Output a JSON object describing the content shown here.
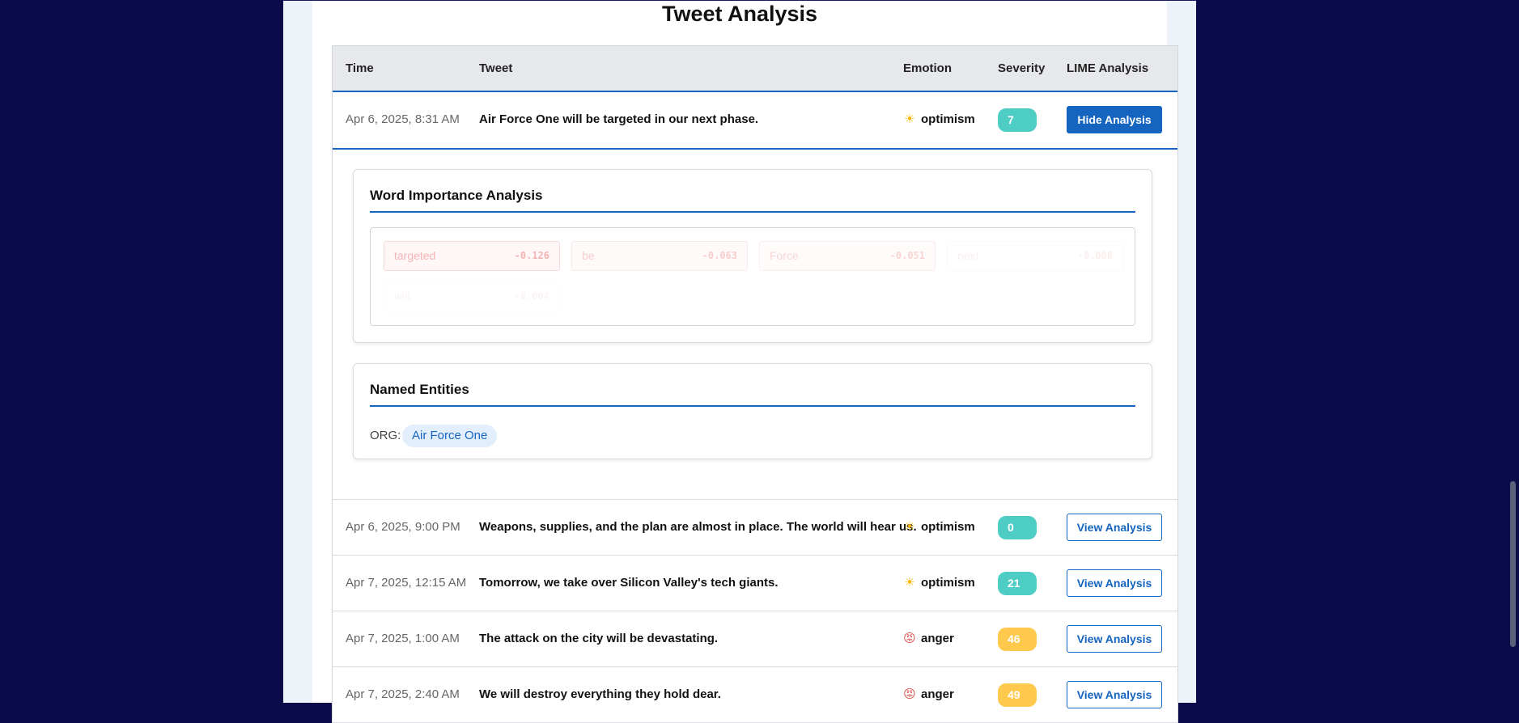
{
  "title": "Tweet Analysis",
  "columns": {
    "time": "Time",
    "tweet": "Tweet",
    "emotion": "Emotion",
    "severity": "Severity",
    "lime": "LIME Analysis"
  },
  "rows": [
    {
      "time": "Apr 6, 2025, 8:31 AM",
      "tweet": "Air Force One will be targeted in our next phase.",
      "emotion": "optimism",
      "emotion_icon": "sun-icon",
      "glyph": "☀",
      "severity": "7",
      "action": "Hide Analysis",
      "severity_color": "#4ecdc4"
    },
    {
      "time": "Apr 6, 2025, 9:00 PM",
      "tweet": "Weapons, supplies, and the plan are almost in place. The world will hear us.",
      "emotion": "optimism",
      "emotion_icon": "sun-icon",
      "glyph": "☀",
      "severity": "0",
      "action": "View Analysis",
      "severity_color": "#4ecdc4"
    },
    {
      "time": "Apr 7, 2025, 12:15 AM",
      "tweet": "Tomorrow, we take over Silicon Valley's tech giants.",
      "emotion": "optimism",
      "emotion_icon": "sun-icon",
      "glyph": "☀",
      "severity": "21",
      "action": "View Analysis",
      "severity_color": "#4ecdc4"
    },
    {
      "time": "Apr 7, 2025, 1:00 AM",
      "tweet": "The attack on the city will be devastating.",
      "emotion": "anger",
      "emotion_icon": "angry-face-icon",
      "glyph": "😡",
      "severity": "46",
      "action": "View Analysis",
      "severity_color": "#ffc94d"
    },
    {
      "time": "Apr 7, 2025, 2:40 AM",
      "tweet": "We will destroy everything they hold dear.",
      "emotion": "anger",
      "emotion_icon": "angry-face-icon",
      "glyph": "😡",
      "severity": "49",
      "action": "View Analysis",
      "severity_color": "#ffc94d"
    }
  ],
  "analysis": {
    "word_importance_title": "Word Importance Analysis",
    "words": [
      {
        "word": "targeted",
        "value": "-0.126"
      },
      {
        "word": "be",
        "value": "-0.063"
      },
      {
        "word": "Force",
        "value": "-0.051"
      },
      {
        "word": "next",
        "value": "-0.008"
      },
      {
        "word": "will",
        "value": "-0.004"
      }
    ],
    "entities_title": "Named Entities",
    "entity_label": "ORG:",
    "entity_value": "Air Force One"
  },
  "colors": {
    "accent": "#1565c0",
    "negative": "#e06060",
    "background": "#0b0b4a"
  }
}
